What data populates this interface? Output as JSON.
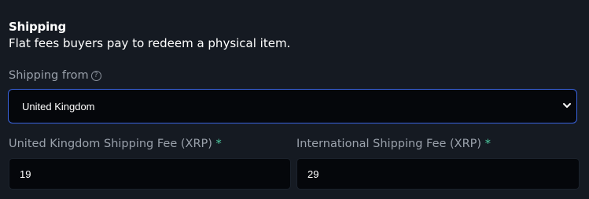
{
  "section": {
    "title": "Shipping",
    "subtitle": "Flat fees buyers pay to redeem a physical item."
  },
  "shipping_from": {
    "label": "Shipping from",
    "help_icon": "question-circle-icon",
    "selected_value": "United Kingdom",
    "dropdown_icon": "chevron-down-icon"
  },
  "domestic_fee": {
    "label": "United Kingdom Shipping Fee (XRP)",
    "required_marker": "*",
    "value": "19"
  },
  "international_fee": {
    "label": "International Shipping Fee (XRP)",
    "required_marker": "*",
    "value": "29"
  },
  "colors": {
    "background": "#151a22",
    "input_background": "#05070b",
    "focus_border": "#3a64e0",
    "required_marker": "#4fd1a5",
    "label_text": "#9aa1ab"
  }
}
